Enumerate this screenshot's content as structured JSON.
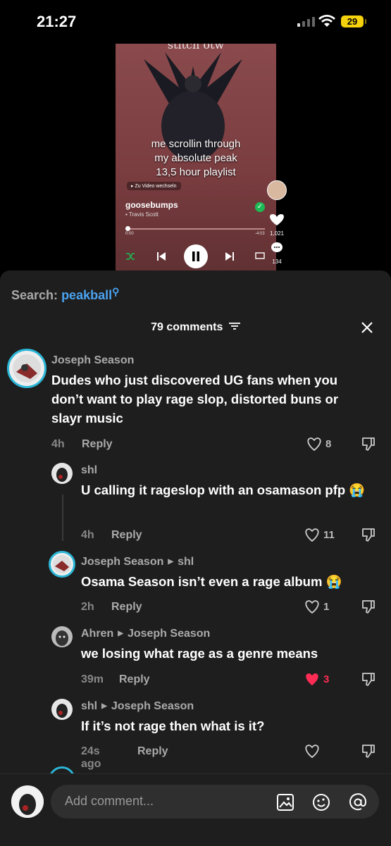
{
  "status": {
    "time": "21:27",
    "battery": "29"
  },
  "video": {
    "top_caption": "stitch otw",
    "caption_lines": [
      "me scrollin through",
      "my absolute peak",
      "13,5 hour playlist"
    ],
    "switch_label": "Zu Video wechseln",
    "song": "goosebumps",
    "artist": "Travis Scott",
    "time_start": "0:00",
    "time_end": "-4:03",
    "likes": "1,021",
    "comments_count": "134"
  },
  "search": {
    "label": "Search:",
    "query": "peakball"
  },
  "comments_header": "79 comments",
  "comments": [
    {
      "user": "Joseph Season",
      "reply_to": "",
      "text": "Dudes who just discovered UG fans when you don’t want to play rage slop, distorted buns or slayr music",
      "time": "4h",
      "reply_label": "Reply",
      "likes": "8",
      "liked": false
    },
    {
      "user": "shl",
      "reply_to": "",
      "text": "U calling it rageslop with an osamason pfp 😭",
      "time": "4h",
      "reply_label": "Reply",
      "likes": "11",
      "liked": false
    },
    {
      "user": "Joseph Season",
      "reply_to": "shl",
      "text": "Osama Season isn’t even a rage album 😭",
      "time": "2h",
      "reply_label": "Reply",
      "likes": "1",
      "liked": false
    },
    {
      "user": "Ahren",
      "reply_to": "Joseph Season",
      "text": "we losing what rage as a genre means",
      "time": "39m",
      "reply_label": "Reply",
      "likes": "3",
      "liked": true
    },
    {
      "user": "shl",
      "reply_to": "Joseph Season",
      "text": "If it’s not rage then what is it?",
      "time": "24s ago",
      "reply_label": "Reply",
      "likes": "",
      "liked": false
    }
  ],
  "input": {
    "placeholder": "Add comment..."
  },
  "colors": {
    "accent_blue": "#4aa3f0",
    "like_red": "#fe2c55",
    "sheet_bg": "#1e1e1e"
  }
}
